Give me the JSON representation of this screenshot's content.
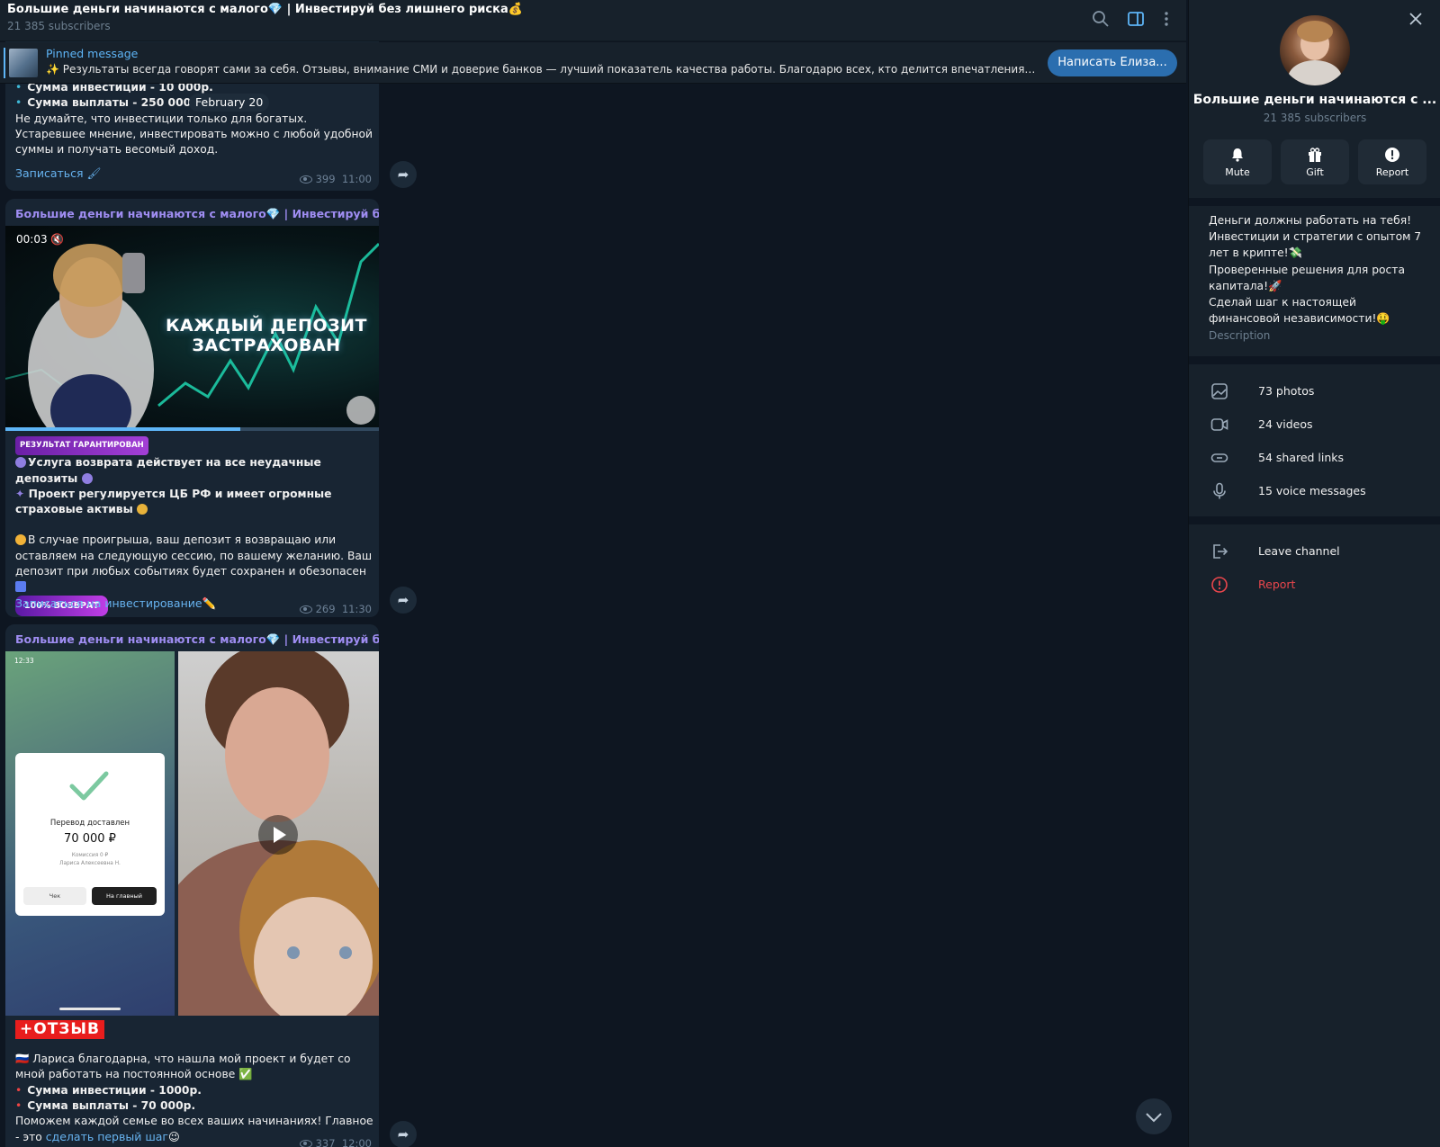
{
  "header": {
    "title": "Большие деньги начинаются с малого💎 | Инвестируй без лишнего риска💰",
    "subscribers": "21 385 subscribers"
  },
  "pinned": {
    "label": "Pinned message",
    "text": "✨ Результаты всегда говорят сами за себя. Отзывы, внимание СМИ и доверие банков — лучший показатель качества работы.  Благодарю всех, кто делится впечатлениями 🙏 Это ...",
    "button": "Написать Елиза..."
  },
  "date_pill": "February 20",
  "messages": [
    {
      "bullet1": "Сумма инвестиции - 10 000р.",
      "bullet2": "Сумма выплаты - 250 000р.",
      "text": "Не думайте, что инвестиции только для богатых. Устаревшее мнение, инвестировать можно с любой удобной суммы и получать весомый доход.",
      "link": "Записаться 🖌",
      "views": "399",
      "time": "11:00"
    },
    {
      "sender": "Большие деньги начинаются с малого💎 | Инвестируй без ...",
      "video_time": "00:03",
      "video_title": "КАЖДЫЙ ДЕПОЗИТ ЗАСТРАХОВАН",
      "badge": "РЕЗУЛЬТАТ ГАРАНТИРОВАН",
      "line1": "Услуга возврата действует на все неудачные депозиты",
      "line2": "Проект регулируется ЦБ РФ и имеет огромные страховые активы",
      "para": "В случае проигрыша, ваш депозит я возвращаю или оставляем на следующую сессию, по вашему желанию. Ваш депозит при любых событиях будет сохранен и обезопасен",
      "badge2": "100% ВОЗВРАТ",
      "link": "Записаться на инвестирование✏️",
      "views": "269",
      "time": "11:30"
    },
    {
      "sender": "Большие деньги начинаются с малого💎 | Инвестируй без ...",
      "phone_time": "12:33",
      "receipt_title": "Перевод доставлен",
      "receipt_amount": "70 000 ₽",
      "receipt_fee": "Комиссия 0 ₽",
      "receipt_name": "Лариса Алексеевна Н.",
      "receipt_btn1": "Чек",
      "receipt_btn2": "На главный",
      "tag": "+ОТЗЫВ",
      "para": "🇷🇺 Лариса благодарна, что нашла мой проект и будет со мной работать на постоянной основе ✅",
      "bullet1": "Сумма инвестиции - 1000р.",
      "bullet2": "Сумма выплаты - 70 000р.",
      "text": "Поможем каждой семье во всех ваших начинаниях! Главное - это",
      "link": "сделать первый шаг",
      "emoji": "😉",
      "views": "337",
      "time": "12:00"
    }
  ],
  "panel": {
    "title": "Большие деньги начинаются с ...",
    "subscribers": "21 385 subscribers",
    "actions": [
      {
        "label": "Mute",
        "icon": "bell-icon"
      },
      {
        "label": "Gift",
        "icon": "gift-icon"
      },
      {
        "label": "Report",
        "icon": "alert-icon"
      }
    ],
    "description": "Деньги должны работать на тебя!\nИнвестиции и стратегии с опытом 7 лет в крипте!💸\nПроверенные решения для роста капитала!🚀\nСделай шаг к настоящей финансовой независимости!🤑",
    "description_label": "Description",
    "media": [
      {
        "label": "73 photos",
        "icon": "photo-icon"
      },
      {
        "label": "24 videos",
        "icon": "video-icon"
      },
      {
        "label": "54 shared links",
        "icon": "link-icon"
      },
      {
        "label": "15 voice messages",
        "icon": "mic-icon"
      }
    ],
    "leave": "Leave channel",
    "report": "Report"
  },
  "colors": {
    "accent": "#5eb5f7",
    "sender": "#9f8df2",
    "danger": "#e9464c",
    "button": "#2b6eaf"
  }
}
